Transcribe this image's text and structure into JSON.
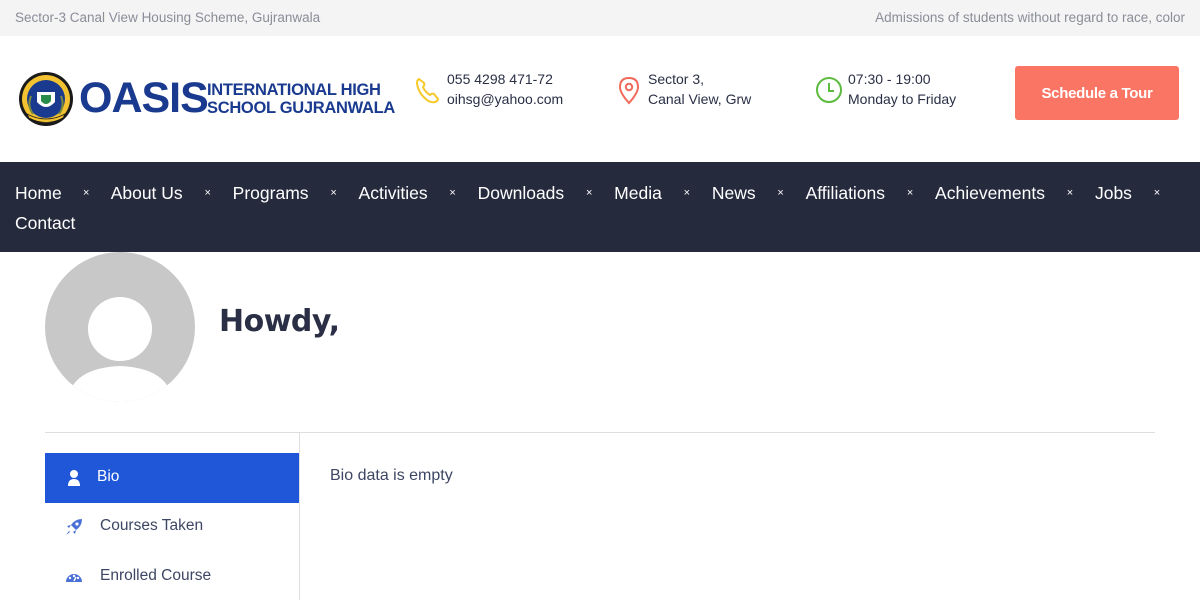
{
  "topbar": {
    "address": "Sector-3 Canal View Housing Scheme, Gujranwala",
    "notice": "Admissions of students without regard to race, color"
  },
  "header": {
    "logo": {
      "brand": "OASIS",
      "subtitle_line1": "INTERNATIONAL HIGH",
      "subtitle_line2": "SCHOOL GUJRANWALA",
      "seal_text": "ARE LEAD SUCCESS"
    },
    "phone": {
      "icon": "phone-icon",
      "line1": "055 4298 471-72",
      "line2": "oihsg@yahoo.com"
    },
    "address": {
      "icon": "map-pin-icon",
      "line1": "Sector 3,",
      "line2": "Canal View, Grw"
    },
    "hours": {
      "icon": "clock-icon",
      "line1": "07:30 - 19:00",
      "line2": "Monday to Friday"
    },
    "cta_label": "Schedule a Tour",
    "colors": {
      "brand": "#1a3a8f",
      "phone_icon": "#f5c928",
      "pin_icon": "#ef6a5a",
      "clock_icon": "#5dbb3f",
      "cta": "#fb7564"
    }
  },
  "nav": {
    "items": [
      "Home",
      "About Us",
      "Programs",
      "Activities",
      "Downloads",
      "Media",
      "News",
      "Affiliations",
      "Achievements",
      "Jobs",
      "Contact"
    ],
    "separator": "×",
    "background": "#262a3d"
  },
  "profile": {
    "greeting": "Howdy,",
    "avatar_icon": "default-avatar-icon"
  },
  "sidebar": {
    "items": [
      {
        "label": "Bio",
        "icon": "user-icon",
        "active": true
      },
      {
        "label": "Courses Taken",
        "icon": "rocket-icon",
        "active": false
      },
      {
        "label": "Enrolled Course",
        "icon": "dashboard-icon",
        "active": false
      }
    ],
    "active_color": "#1f57d8"
  },
  "content": {
    "bio_text": "Bio data is empty"
  }
}
